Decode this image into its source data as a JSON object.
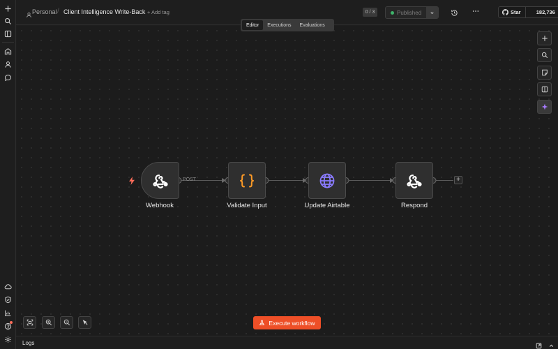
{
  "rail": {
    "top_icons": [
      "plus-icon",
      "search-icon",
      "sidebar-toggle-icon"
    ],
    "nav_icons": [
      "home-icon",
      "user-icon",
      "chat-icon"
    ],
    "bottom_icons": [
      "cloud-icon",
      "shield-icon",
      "chart-icon",
      "help-icon",
      "settings-icon"
    ]
  },
  "breadcrumb": {
    "parent": "Personal",
    "separator": "/",
    "workflow_name": "Client Intelligence Write-Back",
    "add_tag": "+ Add tag"
  },
  "header": {
    "counter": "0 / 3",
    "publish_label": "Published",
    "publish_status_color": "#3eb36a",
    "github_star_label": "Star",
    "github_star_count": "182,736"
  },
  "tabs": [
    {
      "label": "Editor",
      "active": true
    },
    {
      "label": "Executions",
      "active": false
    },
    {
      "label": "Evaluations",
      "active": false
    }
  ],
  "workflow": {
    "trigger_method": "POST",
    "nodes": [
      {
        "label": "Webhook",
        "icon": "webhook-icon"
      },
      {
        "label": "Validate Input",
        "icon": "code-braces-icon",
        "icon_color": "#ff9b26"
      },
      {
        "label": "Update Airtable",
        "icon": "globe-icon",
        "icon_color": "#8a7bff"
      },
      {
        "label": "Respond",
        "icon": "webhook-icon"
      }
    ]
  },
  "footer": {
    "execute_label": "Execute workflow",
    "execute_color": "#ee4f27",
    "logs_label": "Logs"
  }
}
